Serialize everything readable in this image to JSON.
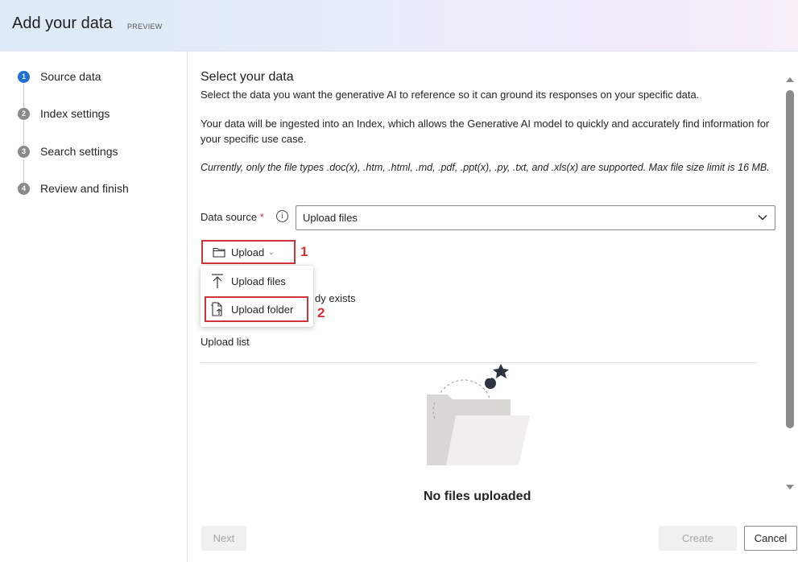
{
  "header": {
    "title": "Add your data",
    "badge": "PREVIEW"
  },
  "steps": [
    {
      "number": "1",
      "label": "Source data",
      "active": true
    },
    {
      "number": "2",
      "label": "Index settings",
      "active": false
    },
    {
      "number": "3",
      "label": "Search settings",
      "active": false
    },
    {
      "number": "4",
      "label": "Review and finish",
      "active": false
    }
  ],
  "main": {
    "title": "Select your data",
    "intro": "Select the data you want the generative AI to reference so it can ground its responses on your specific data.",
    "ingest": "Your data will be ingested into an Index, which allows the Generative AI model to quickly and accurately find information for your specific use case.",
    "filetypes": "Currently, only the file types .doc(x), .htm, .html, .md, .pdf, .ppt(x), .py, .txt, and .xls(x) are supported. Max file size limit is 16 MB."
  },
  "data_source": {
    "label": "Data source",
    "required_mark": "*",
    "info_glyph": "i",
    "value": "Upload files"
  },
  "upload_button": {
    "label": "Upload"
  },
  "upload_menu": {
    "items": [
      "Upload files",
      "Upload folder"
    ]
  },
  "annotations": {
    "first": "1",
    "second": "2"
  },
  "obscured_text": "dy exists",
  "upload_list": {
    "label": "Upload list",
    "empty_title": "No files uploaded"
  },
  "footer": {
    "next": "Next",
    "create": "Create",
    "cancel": "Cancel"
  },
  "colors": {
    "accent": "#1f6fd1",
    "annotation": "#d13438"
  },
  "icons": [
    "folder-icon",
    "chevron-down-icon",
    "upload-arrow-icon",
    "folder-upload-icon",
    "info-icon",
    "empty-folder-illustration"
  ]
}
